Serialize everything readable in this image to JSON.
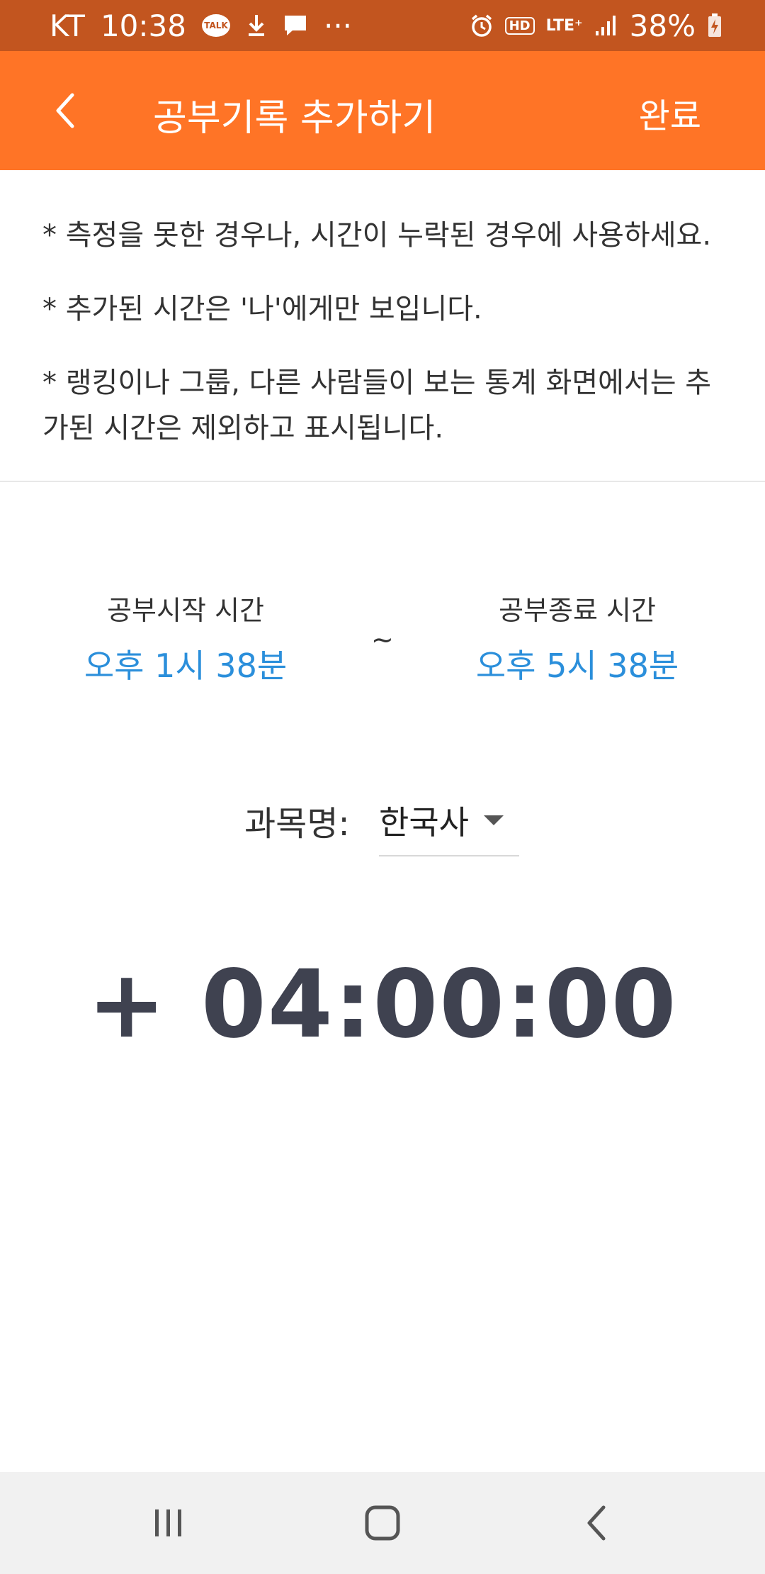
{
  "status_bar": {
    "carrier": "KT",
    "time": "10:38",
    "talk_label": "TALK",
    "more": "···",
    "hd": "HD",
    "lte": "LTE⁺",
    "battery": "38%"
  },
  "app_bar": {
    "title": "공부기록 추가하기",
    "done_label": "완료",
    "color": "#ff7426"
  },
  "notices": [
    "* 측정을 못한 경우나, 시간이 누락된 경우에 사용하세요.",
    "* 추가된 시간은 '나'에게만 보입니다.",
    "* 랭킹이나 그룹, 다른 사람들이 보는 통계 화면에서는 추가된 시간은 제외하고 표시됩니다."
  ],
  "time_range": {
    "start_label": "공부시작 시간",
    "start_value": "오후 1시 38분",
    "separator": "~",
    "end_label": "공부종료 시간",
    "end_value": "오후 5시 38분",
    "value_color": "#2b8fdb"
  },
  "subject": {
    "label": "과목명:",
    "selected": "한국사"
  },
  "timer": {
    "value": "+ 04:00:00"
  },
  "nav_bar": {
    "recents": "recents-icon",
    "home": "home-icon",
    "back": "back-icon"
  }
}
